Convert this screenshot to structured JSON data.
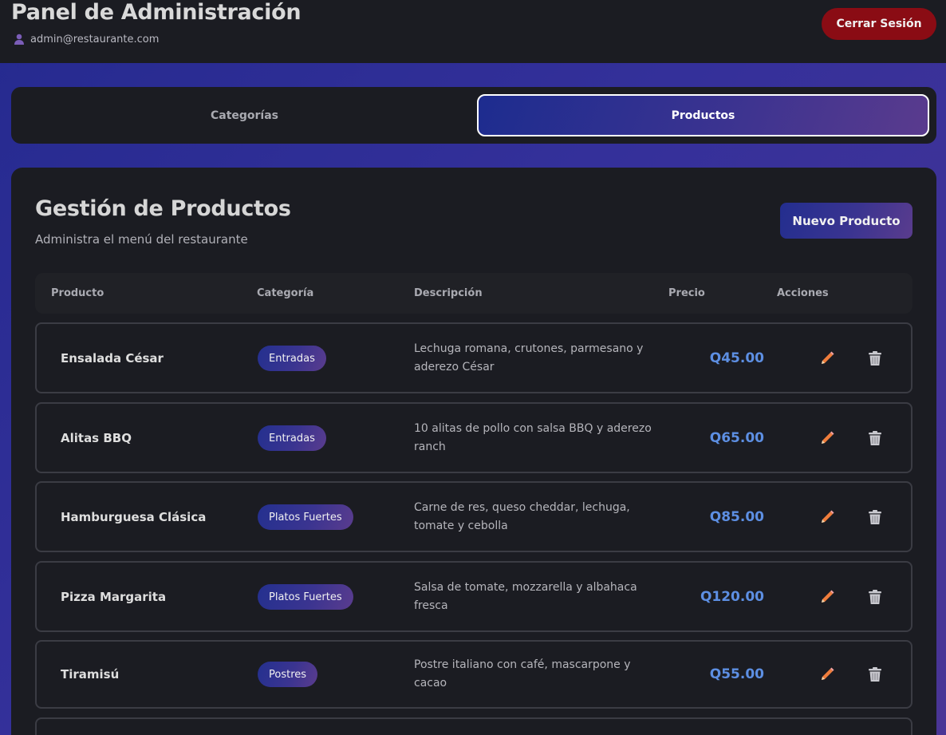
{
  "header": {
    "title": "Panel de Administración",
    "user_email": "admin@restaurante.com",
    "logout_label": "Cerrar Sesión",
    "user_icon": "user-icon"
  },
  "tabs": [
    {
      "label": "Categorías",
      "active": false
    },
    {
      "label": "Productos",
      "active": true
    }
  ],
  "main": {
    "title": "Gestión de Productos",
    "subtitle": "Administra el menú del restaurante",
    "new_button_label": "Nuevo Producto",
    "columns": [
      "Producto",
      "Categoría",
      "Descripción",
      "Precio",
      "Acciones"
    ],
    "rows": [
      {
        "name": "Ensalada César",
        "category": "Entradas",
        "description": "Lechuga romana, crutones, parmesano y aderezo César",
        "price": "Q45.00"
      },
      {
        "name": "Alitas BBQ",
        "category": "Entradas",
        "description": "10 alitas de pollo con salsa BBQ y aderezo ranch",
        "price": "Q65.00"
      },
      {
        "name": "Hamburguesa Clásica",
        "category": "Platos Fuertes",
        "description": "Carne de res, queso cheddar, lechuga, tomate y cebolla",
        "price": "Q85.00"
      },
      {
        "name": "Pizza Margarita",
        "category": "Platos Fuertes",
        "description": "Salsa de tomate, mozzarella y albahaca fresca",
        "price": "Q120.00"
      },
      {
        "name": "Tiramisú",
        "category": "Postres",
        "description": "Postre italiano con café, mascarpone y cacao",
        "price": "Q55.00"
      }
    ],
    "action_icons": {
      "edit": "pencil-icon",
      "delete": "trash-icon"
    }
  },
  "colors": {
    "accent": "#3a3490",
    "danger": "#8a0c14",
    "price": "#5d8fe3",
    "surface": "#1b1c22"
  }
}
